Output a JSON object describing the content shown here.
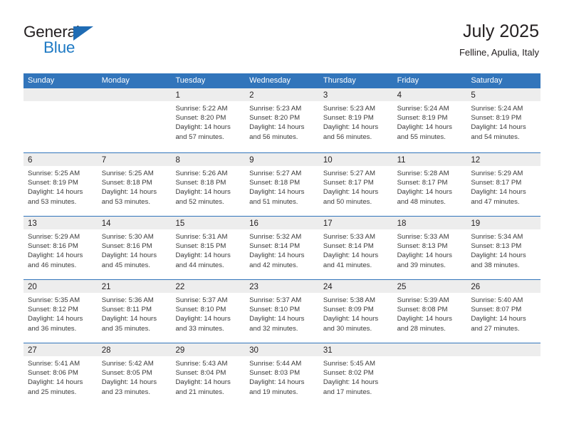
{
  "brand": {
    "name_top": "General",
    "name_bottom": "Blue",
    "triangle_color": "#1f6cb4",
    "top_color": "#231f20",
    "bottom_color": "#1f7ac4"
  },
  "header": {
    "title": "July 2025",
    "subtitle": "Felline, Apulia, Italy"
  },
  "colors": {
    "header_band": "#3275bb",
    "row_separator": "#3275bb",
    "day_strip": "#ededed",
    "text": "#231f20"
  },
  "calendar": {
    "weekdays": [
      "Sunday",
      "Monday",
      "Tuesday",
      "Wednesday",
      "Thursday",
      "Friday",
      "Saturday"
    ],
    "weeks": [
      [
        {
          "day": "",
          "lines": []
        },
        {
          "day": "",
          "lines": []
        },
        {
          "day": "1",
          "lines": [
            "Sunrise: 5:22 AM",
            "Sunset: 8:20 PM",
            "Daylight: 14 hours",
            "and 57 minutes."
          ]
        },
        {
          "day": "2",
          "lines": [
            "Sunrise: 5:23 AM",
            "Sunset: 8:20 PM",
            "Daylight: 14 hours",
            "and 56 minutes."
          ]
        },
        {
          "day": "3",
          "lines": [
            "Sunrise: 5:23 AM",
            "Sunset: 8:19 PM",
            "Daylight: 14 hours",
            "and 56 minutes."
          ]
        },
        {
          "day": "4",
          "lines": [
            "Sunrise: 5:24 AM",
            "Sunset: 8:19 PM",
            "Daylight: 14 hours",
            "and 55 minutes."
          ]
        },
        {
          "day": "5",
          "lines": [
            "Sunrise: 5:24 AM",
            "Sunset: 8:19 PM",
            "Daylight: 14 hours",
            "and 54 minutes."
          ]
        }
      ],
      [
        {
          "day": "6",
          "lines": [
            "Sunrise: 5:25 AM",
            "Sunset: 8:19 PM",
            "Daylight: 14 hours",
            "and 53 minutes."
          ]
        },
        {
          "day": "7",
          "lines": [
            "Sunrise: 5:25 AM",
            "Sunset: 8:18 PM",
            "Daylight: 14 hours",
            "and 53 minutes."
          ]
        },
        {
          "day": "8",
          "lines": [
            "Sunrise: 5:26 AM",
            "Sunset: 8:18 PM",
            "Daylight: 14 hours",
            "and 52 minutes."
          ]
        },
        {
          "day": "9",
          "lines": [
            "Sunrise: 5:27 AM",
            "Sunset: 8:18 PM",
            "Daylight: 14 hours",
            "and 51 minutes."
          ]
        },
        {
          "day": "10",
          "lines": [
            "Sunrise: 5:27 AM",
            "Sunset: 8:17 PM",
            "Daylight: 14 hours",
            "and 50 minutes."
          ]
        },
        {
          "day": "11",
          "lines": [
            "Sunrise: 5:28 AM",
            "Sunset: 8:17 PM",
            "Daylight: 14 hours",
            "and 48 minutes."
          ]
        },
        {
          "day": "12",
          "lines": [
            "Sunrise: 5:29 AM",
            "Sunset: 8:17 PM",
            "Daylight: 14 hours",
            "and 47 minutes."
          ]
        }
      ],
      [
        {
          "day": "13",
          "lines": [
            "Sunrise: 5:29 AM",
            "Sunset: 8:16 PM",
            "Daylight: 14 hours",
            "and 46 minutes."
          ]
        },
        {
          "day": "14",
          "lines": [
            "Sunrise: 5:30 AM",
            "Sunset: 8:16 PM",
            "Daylight: 14 hours",
            "and 45 minutes."
          ]
        },
        {
          "day": "15",
          "lines": [
            "Sunrise: 5:31 AM",
            "Sunset: 8:15 PM",
            "Daylight: 14 hours",
            "and 44 minutes."
          ]
        },
        {
          "day": "16",
          "lines": [
            "Sunrise: 5:32 AM",
            "Sunset: 8:14 PM",
            "Daylight: 14 hours",
            "and 42 minutes."
          ]
        },
        {
          "day": "17",
          "lines": [
            "Sunrise: 5:33 AM",
            "Sunset: 8:14 PM",
            "Daylight: 14 hours",
            "and 41 minutes."
          ]
        },
        {
          "day": "18",
          "lines": [
            "Sunrise: 5:33 AM",
            "Sunset: 8:13 PM",
            "Daylight: 14 hours",
            "and 39 minutes."
          ]
        },
        {
          "day": "19",
          "lines": [
            "Sunrise: 5:34 AM",
            "Sunset: 8:13 PM",
            "Daylight: 14 hours",
            "and 38 minutes."
          ]
        }
      ],
      [
        {
          "day": "20",
          "lines": [
            "Sunrise: 5:35 AM",
            "Sunset: 8:12 PM",
            "Daylight: 14 hours",
            "and 36 minutes."
          ]
        },
        {
          "day": "21",
          "lines": [
            "Sunrise: 5:36 AM",
            "Sunset: 8:11 PM",
            "Daylight: 14 hours",
            "and 35 minutes."
          ]
        },
        {
          "day": "22",
          "lines": [
            "Sunrise: 5:37 AM",
            "Sunset: 8:10 PM",
            "Daylight: 14 hours",
            "and 33 minutes."
          ]
        },
        {
          "day": "23",
          "lines": [
            "Sunrise: 5:37 AM",
            "Sunset: 8:10 PM",
            "Daylight: 14 hours",
            "and 32 minutes."
          ]
        },
        {
          "day": "24",
          "lines": [
            "Sunrise: 5:38 AM",
            "Sunset: 8:09 PM",
            "Daylight: 14 hours",
            "and 30 minutes."
          ]
        },
        {
          "day": "25",
          "lines": [
            "Sunrise: 5:39 AM",
            "Sunset: 8:08 PM",
            "Daylight: 14 hours",
            "and 28 minutes."
          ]
        },
        {
          "day": "26",
          "lines": [
            "Sunrise: 5:40 AM",
            "Sunset: 8:07 PM",
            "Daylight: 14 hours",
            "and 27 minutes."
          ]
        }
      ],
      [
        {
          "day": "27",
          "lines": [
            "Sunrise: 5:41 AM",
            "Sunset: 8:06 PM",
            "Daylight: 14 hours",
            "and 25 minutes."
          ]
        },
        {
          "day": "28",
          "lines": [
            "Sunrise: 5:42 AM",
            "Sunset: 8:05 PM",
            "Daylight: 14 hours",
            "and 23 minutes."
          ]
        },
        {
          "day": "29",
          "lines": [
            "Sunrise: 5:43 AM",
            "Sunset: 8:04 PM",
            "Daylight: 14 hours",
            "and 21 minutes."
          ]
        },
        {
          "day": "30",
          "lines": [
            "Sunrise: 5:44 AM",
            "Sunset: 8:03 PM",
            "Daylight: 14 hours",
            "and 19 minutes."
          ]
        },
        {
          "day": "31",
          "lines": [
            "Sunrise: 5:45 AM",
            "Sunset: 8:02 PM",
            "Daylight: 14 hours",
            "and 17 minutes."
          ]
        },
        {
          "day": "",
          "lines": []
        },
        {
          "day": "",
          "lines": []
        }
      ]
    ]
  }
}
